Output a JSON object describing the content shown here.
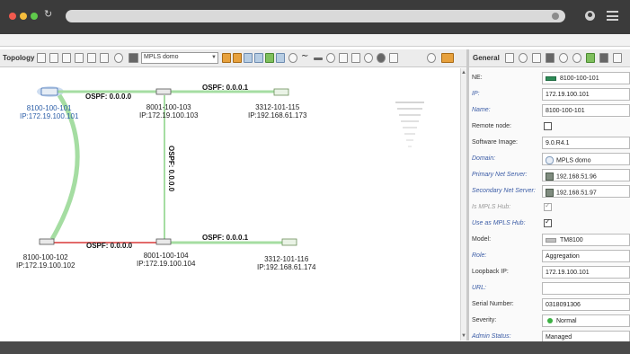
{
  "toolbar": {
    "label": "Topology",
    "select_value": "MPLS domo"
  },
  "topology": {
    "nodes": [
      {
        "id": "n1",
        "label": "8100-100-101",
        "ip": "IP:172.19.100.101",
        "selected": true
      },
      {
        "id": "n2",
        "label": "8001-100-103",
        "ip": "IP:172.19.100.103"
      },
      {
        "id": "n3",
        "label": "3312-101-115",
        "ip": "IP:192.168.61.173"
      },
      {
        "id": "n4",
        "label": "8100-100-102",
        "ip": "IP:172.19.100.102"
      },
      {
        "id": "n5",
        "label": "8001-100-104",
        "ip": "IP:172.19.100.104"
      },
      {
        "id": "n6",
        "label": "3312-101-116",
        "ip": "IP:192.168.61.174"
      }
    ],
    "links": [
      {
        "label": "OSPF: 0.0.0.0"
      },
      {
        "label": "OSPF: 0.0.0.1"
      },
      {
        "label": "OSPF: 0.0.0.0"
      },
      {
        "label": "OSPF: 0.0.0.1"
      },
      {
        "label": "OSPF: 0.0.0.0"
      }
    ]
  },
  "panel": {
    "title": "General",
    "fields": {
      "ne_label": "NE:",
      "ne_value": "8100-100-101",
      "ip_label": "IP:",
      "ip_value": "172.19.100.101",
      "name_label": "Name:",
      "name_value": "8100-100-101",
      "remote_label": "Remote node:",
      "software_label": "Software Image:",
      "software_value": "9.0.R4.1",
      "domain_label": "Domain:",
      "domain_value": "MPLS domo",
      "primary_label": "Primary Net Server:",
      "primary_value": "192.168.51.96",
      "secondary_label": "Secondary Net Server:",
      "secondary_value": "192.168.51.97",
      "is_hub_label": "Is MPLS Hub:",
      "use_hub_label": "Use as MPLS Hub:",
      "model_label": "Model:",
      "model_value": "TM8100",
      "role_label": "Role:",
      "role_value": "Aggregation",
      "loopback_label": "Loopback IP:",
      "loopback_value": "172.19.100.101",
      "url_label": "URL:",
      "url_value": "",
      "serial_label": "Serial Number:",
      "serial_value": "0318091306",
      "severity_label": "Severity:",
      "severity_value": "Normal",
      "admin_label": "Admin Status:",
      "admin_value": "Managed"
    }
  },
  "colors": {
    "ospf_link": "#9fd89c",
    "alarm_link": "#e26a6a",
    "node_blue": "#3f6db3"
  }
}
